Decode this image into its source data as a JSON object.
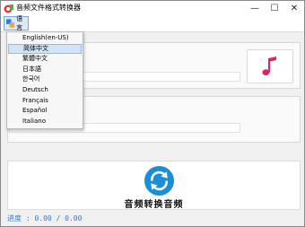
{
  "window": {
    "title": "音频文件格式转换器",
    "controls": {
      "minimize": "—",
      "maximize": "☐",
      "close": "✕"
    }
  },
  "menu": {
    "language_label": "语言"
  },
  "language_menu": {
    "items": [
      {
        "label": "English(en-US)"
      },
      {
        "label": "简体中文",
        "selected": true
      },
      {
        "label": "繁體中文"
      },
      {
        "label": "日本語"
      },
      {
        "label": "한국어"
      },
      {
        "label": "Deutsch"
      },
      {
        "label": "Français"
      },
      {
        "label": "Español"
      },
      {
        "label": "Italiano"
      }
    ]
  },
  "convert": {
    "label": "音频转换音频"
  },
  "progress": {
    "text": "进度 : 0.00 / 0.00"
  },
  "colors": {
    "accent": "#1a8fd8",
    "music": "#e0245e",
    "progress_text": "#2e7fd9"
  },
  "icons": {
    "app": "app-icon",
    "language": "language-icon",
    "music": "music-note-icon",
    "convert": "convert-arrows-icon"
  }
}
